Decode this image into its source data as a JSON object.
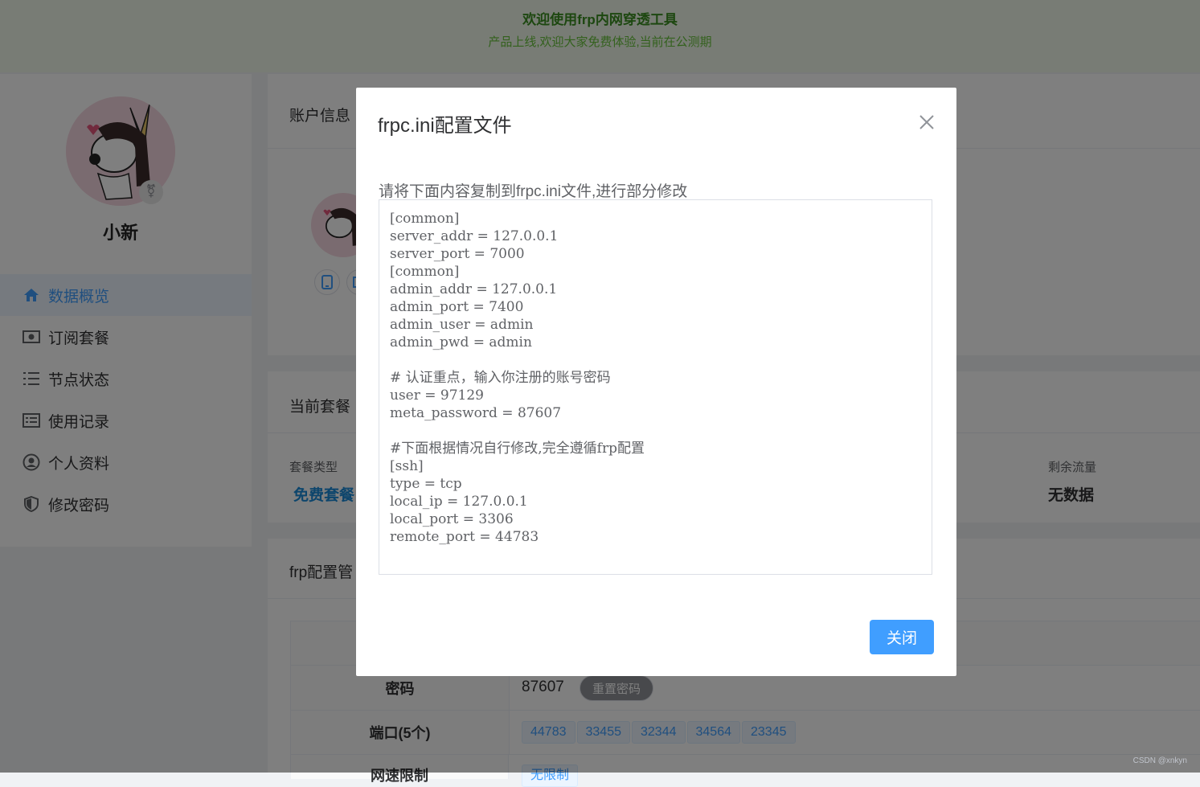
{
  "banner": {
    "title": "欢迎使用frp内网穿透工具",
    "subtitle": "产品上线,欢迎大家免费体验,当前在公测期"
  },
  "sidebar": {
    "username": "小新",
    "menu": [
      {
        "label": "数据概览",
        "icon": "home-icon",
        "active": true
      },
      {
        "label": "订阅套餐",
        "icon": "money-icon",
        "active": false
      },
      {
        "label": "节点状态",
        "icon": "list-icon",
        "active": false
      },
      {
        "label": "使用记录",
        "icon": "record-icon",
        "active": false
      },
      {
        "label": "个人资料",
        "icon": "user-icon",
        "active": false
      },
      {
        "label": "修改密码",
        "icon": "shield-icon",
        "active": false
      }
    ]
  },
  "account": {
    "title": "账户信息"
  },
  "plan": {
    "title": "当前套餐",
    "type_label": "套餐类型",
    "type_value": "免费套餐",
    "traffic_label": "剩余流量",
    "traffic_value": "无数据"
  },
  "frp": {
    "title": "frp配置管",
    "password_label": "密码",
    "password_value": "87607",
    "reset_button": "重置密码",
    "ports_label": "端口(5个)",
    "ports": [
      "44783",
      "33455",
      "32344",
      "34564",
      "23345"
    ],
    "speed_label": "网速限制",
    "speed_value": "无限制"
  },
  "modal": {
    "title": "frpc.ini配置文件",
    "hint": "请将下面内容复制到frpc.ini文件,进行部分修改",
    "config": "[common]\nserver_addr = 127.0.0.1\nserver_port = 7000\n[common]\nadmin_addr = 127.0.0.1\nadmin_port = 7400\nadmin_user = admin\nadmin_pwd = admin\n\n# 认证重点，输入你注册的账号密码\nuser = 97129\nmeta_password = 87607\n\n#下面根据情况自行修改,完全遵循frp配置\n[ssh]\ntype = tcp\nlocal_ip = 127.0.0.1\nlocal_port = 3306\nremote_port = 44783",
    "close_button": "关闭"
  },
  "watermark": "CSDN @xnkyn",
  "colors": {
    "primary": "#409eff",
    "banner_bg": "#f0f9eb",
    "banner_text": "#3a8f21",
    "overlay": "rgba(0,0,0,0.5)"
  }
}
